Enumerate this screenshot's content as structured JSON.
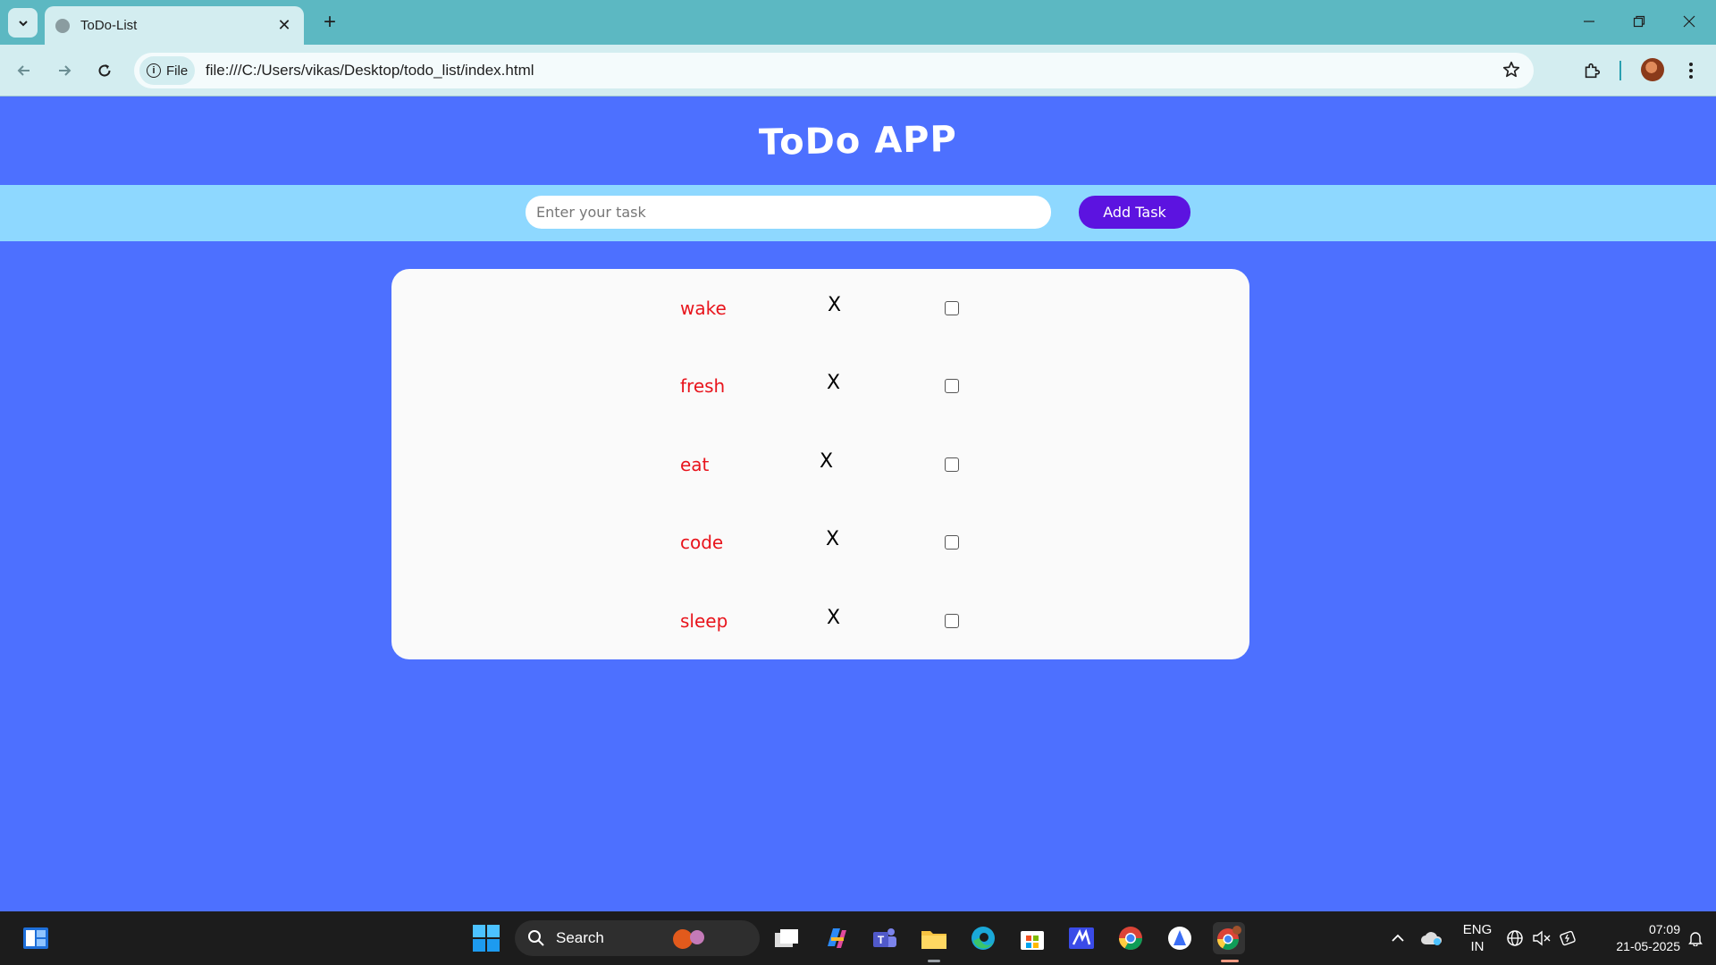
{
  "browser": {
    "tab_title": "ToDo-List",
    "file_chip": "File",
    "url": "file:///C:/Users/vikas/Desktop/todo_list/index.html"
  },
  "app": {
    "title": "ToDo APP",
    "input_placeholder": "Enter your task",
    "input_value": "",
    "add_button": "Add Task",
    "delete_symbol": "X",
    "tasks": [
      {
        "label": "wake",
        "checked": false
      },
      {
        "label": "fresh",
        "checked": false
      },
      {
        "label": "eat",
        "checked": false
      },
      {
        "label": "code",
        "checked": false
      },
      {
        "label": "sleep",
        "checked": false
      }
    ],
    "colors": {
      "background": "#4d70ff",
      "input_bar": "#8ed8ff",
      "button": "#5c13e0",
      "task_text": "#e8141c",
      "card": "#fafafa"
    }
  },
  "taskbar": {
    "search_label": "Search",
    "language_line1": "ENG",
    "language_line2": "IN",
    "time": "07:09",
    "date": "21-05-2025"
  }
}
